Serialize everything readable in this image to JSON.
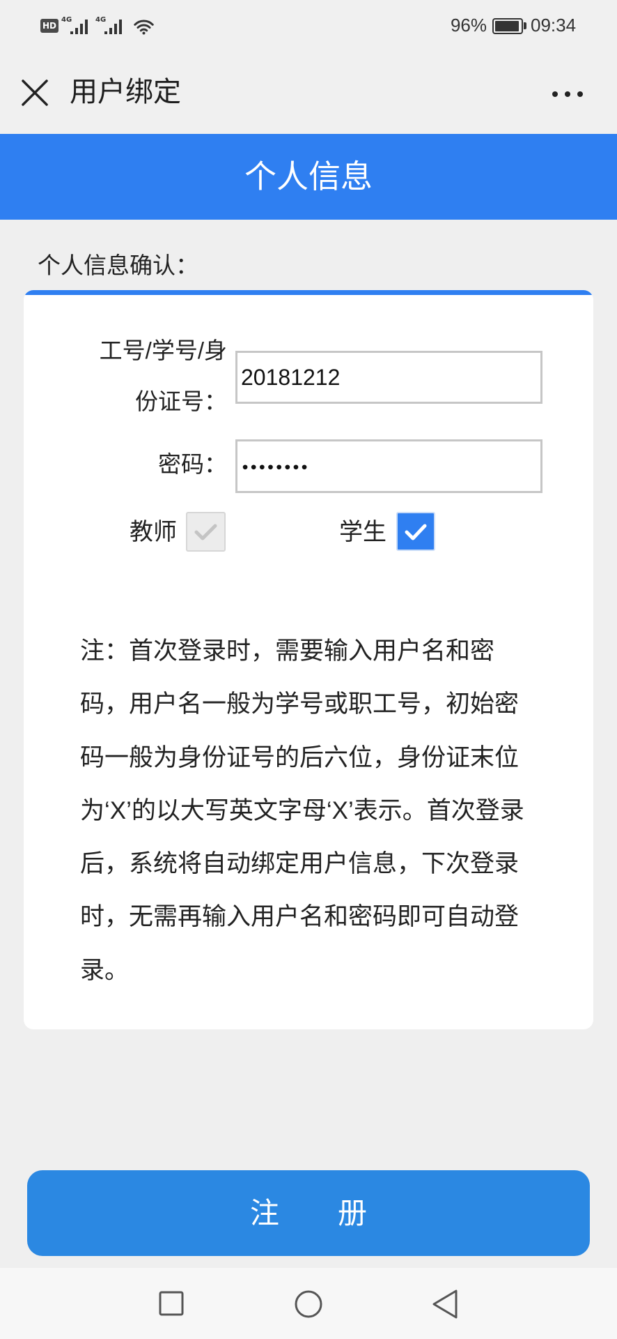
{
  "status_bar": {
    "hd_badge": "HD",
    "network_1": "4G",
    "network_2": "4G",
    "battery_percent": "96%",
    "time": "09:34",
    "icons": [
      "signal-icon",
      "wifi-icon",
      "battery-icon"
    ]
  },
  "title_bar": {
    "title": "用户绑定",
    "close_icon": "close-icon",
    "more_icon": "more-icon"
  },
  "header": {
    "title": "个人信息"
  },
  "section_label": "个人信息确认：",
  "form": {
    "id_label_lines": [
      "工号/学号/身",
      "份证号："
    ],
    "id_value": "20181212",
    "password_label": "密码：",
    "password_value": "••••••••",
    "roles": [
      {
        "label": "教师",
        "checked": false,
        "disabled": true
      },
      {
        "label": "学生",
        "checked": true,
        "disabled": false
      }
    ]
  },
  "note": {
    "lines": [
      "注：首次登录时，需要输入用户名和密",
      "码，用户名一般为学号或职工号，初始密",
      "码一般为身份证号的后六位，身份证末位",
      "为‘X’的以大写英文字母‘X’表示。首次登录",
      "后，系统将自动绑定用户信息，下次登录",
      "时，无需再输入用户名和密码即可自动登",
      "录。"
    ]
  },
  "register_button": {
    "label": "注　　册"
  },
  "nav_bar": {
    "icons": [
      "recent-apps-icon",
      "home-icon",
      "back-icon"
    ]
  },
  "colors": {
    "accent": "#2f7ff1",
    "button": "#2b88e2",
    "page_background": "#efefef",
    "card": "#ffffff"
  }
}
